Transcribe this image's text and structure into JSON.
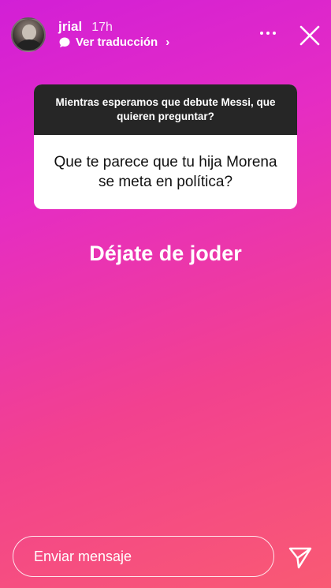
{
  "header": {
    "username": "jrial",
    "time": "17h",
    "translate_label": "Ver traducción",
    "chevron": "›"
  },
  "question_sticker": {
    "prompt": "Mientras esperamos que debute Messi, que quieren preguntar?",
    "question": "Que te parece que tu hija Morena se meta en política?"
  },
  "answer_text": "Déjate de joder",
  "footer": {
    "message_placeholder": "Enviar mensaje"
  },
  "icons": {
    "more": "more-icon",
    "close": "close-icon",
    "translate": "speech-bubble-icon",
    "send": "send-icon"
  },
  "colors": {
    "gradient_start": "#d21fd6",
    "gradient_end": "#f95a73",
    "sticker_header": "#262626"
  }
}
